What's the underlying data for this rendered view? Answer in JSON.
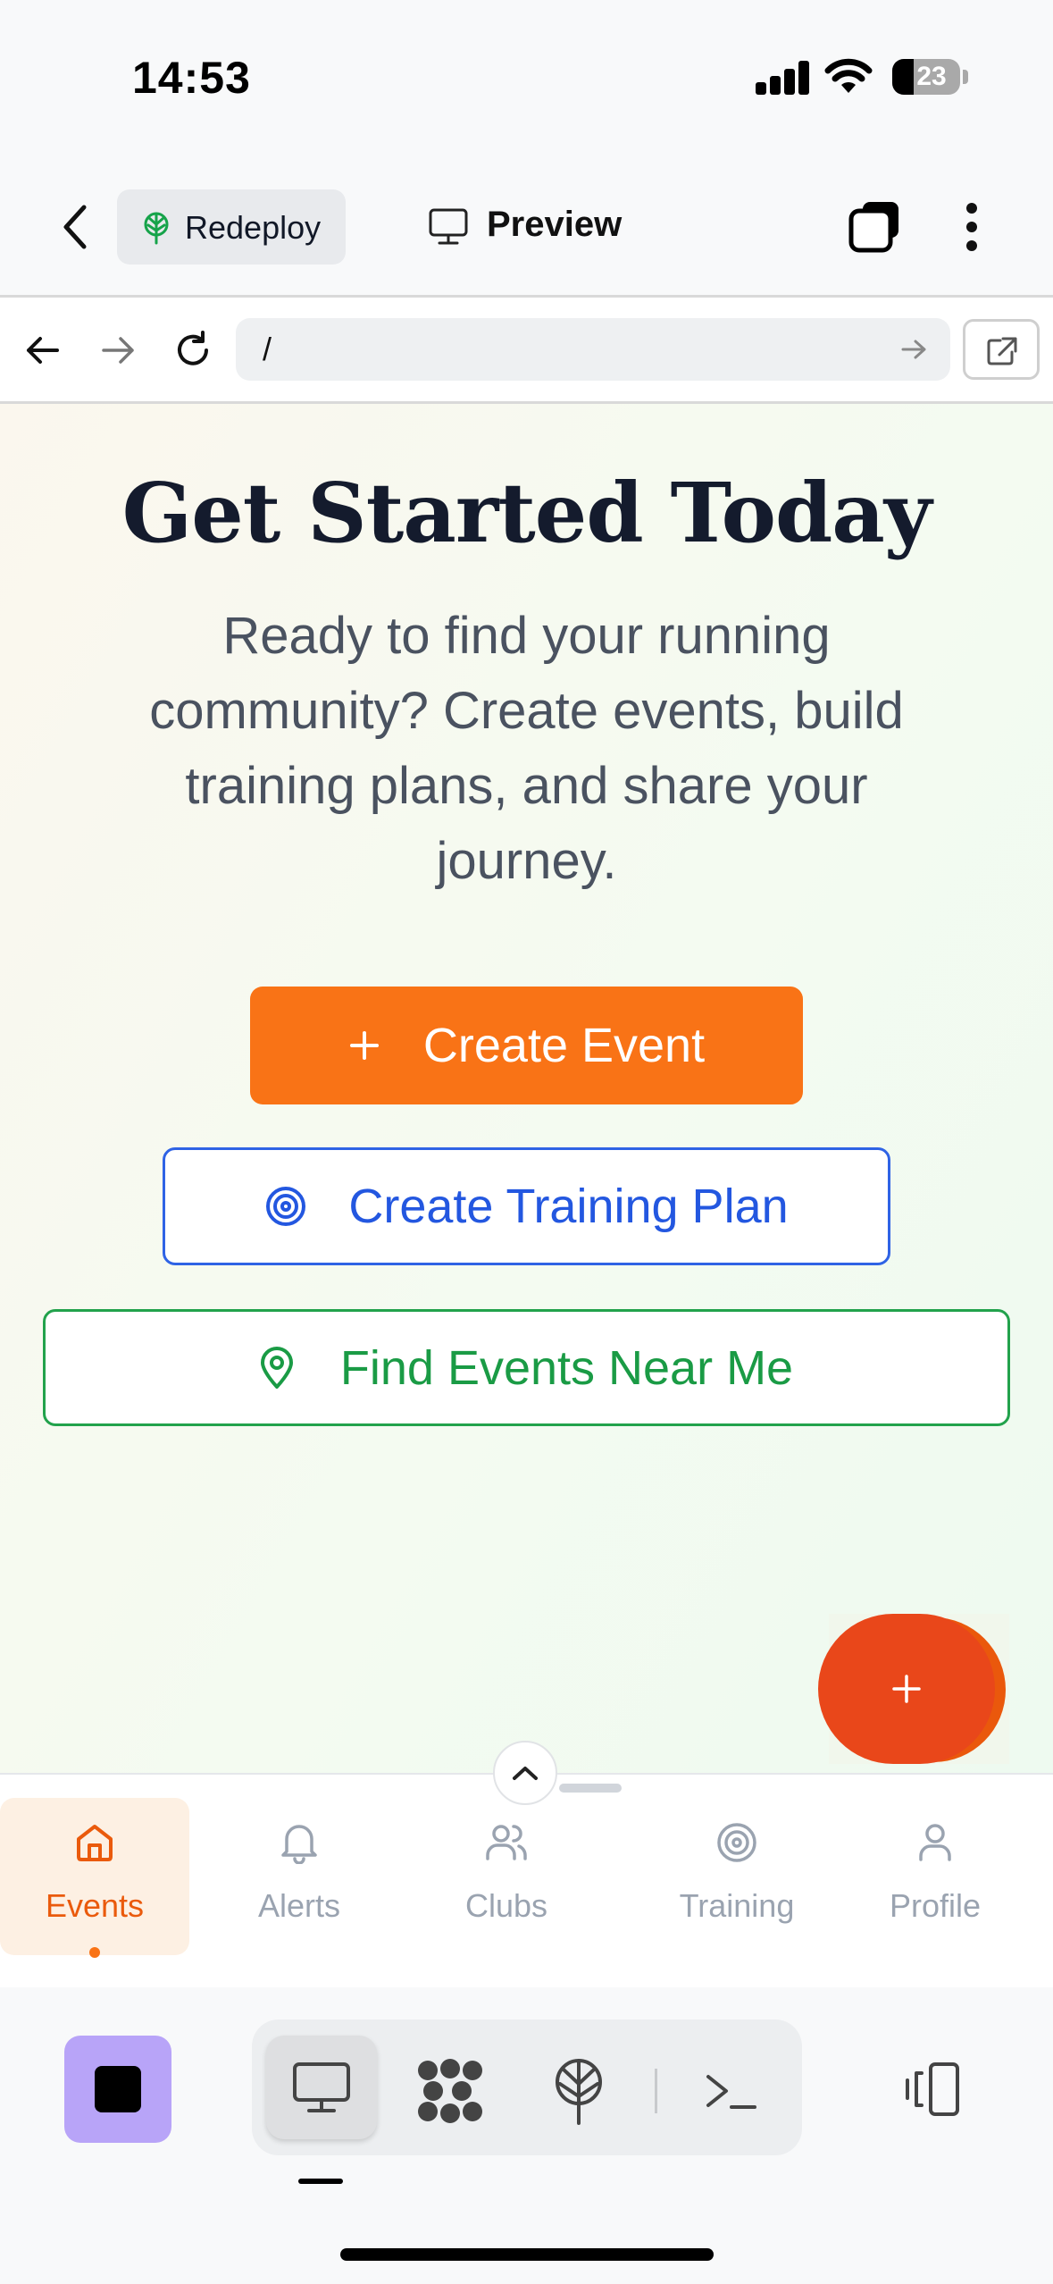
{
  "status_bar": {
    "time": "14:53",
    "battery": "23"
  },
  "app_bar": {
    "redeploy_label": "Redeploy",
    "preview_label": "Preview"
  },
  "browser": {
    "url": "/"
  },
  "hero": {
    "title": "Get Started Today",
    "subtitle": "Ready to find your running community? Create events, build training plans, and share your journey."
  },
  "actions": {
    "create_event": "Create Event",
    "create_training_plan": "Create Training Plan",
    "find_events": "Find Events Near Me"
  },
  "fab": {
    "icon": "plus-icon"
  },
  "tabs": [
    {
      "label": "Events",
      "icon": "home-icon",
      "active": true
    },
    {
      "label": "Alerts",
      "icon": "bell-icon"
    },
    {
      "label": "Clubs",
      "icon": "users-icon"
    },
    {
      "label": "Training",
      "icon": "target-icon"
    },
    {
      "label": "Profile",
      "icon": "user-icon"
    }
  ],
  "dev_toolbar": {
    "modes": [
      "desktop-icon",
      "apps-icon",
      "deploy-icon",
      "terminal-icon"
    ],
    "active_mode": "desktop-icon"
  },
  "colors": {
    "primary_orange": "#f97316",
    "fab_orange": "#e9471a",
    "blue": "#2f63e5",
    "green": "#22a24c",
    "stop_purple": "#b8a4f8"
  }
}
